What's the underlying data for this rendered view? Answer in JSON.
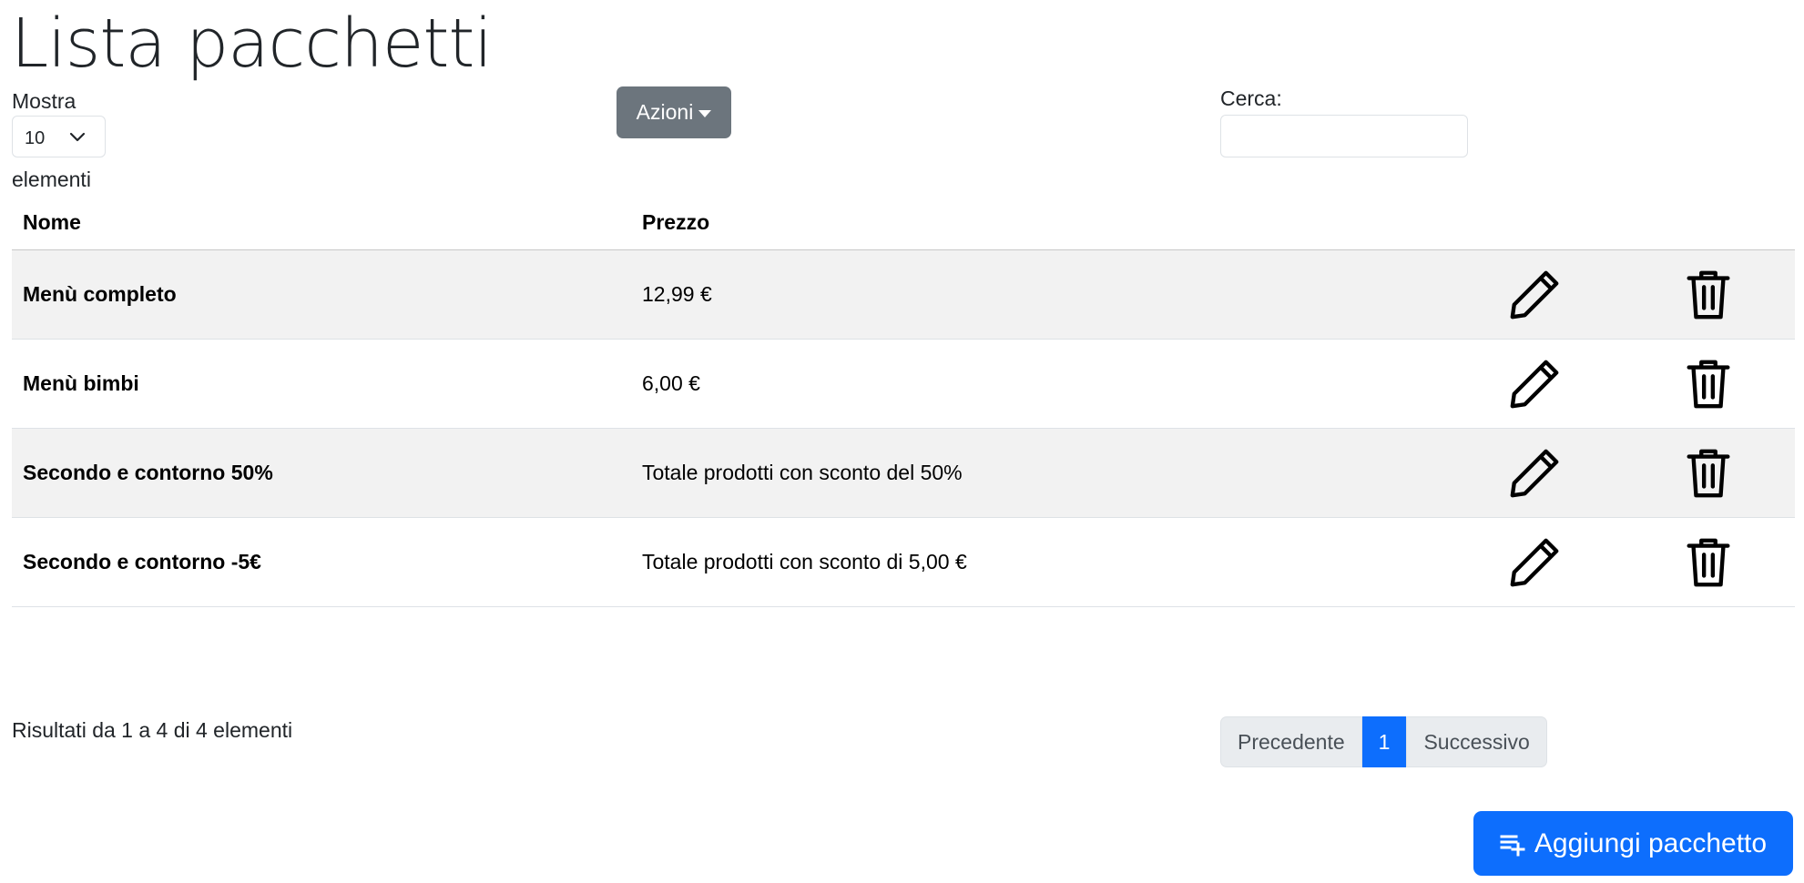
{
  "page": {
    "title": "Lista pacchetti"
  },
  "length_menu": {
    "prefix": "Mostra",
    "value": "10",
    "suffix": "elementi"
  },
  "actions": {
    "label": "Azioni"
  },
  "search": {
    "label": "Cerca:",
    "value": ""
  },
  "table": {
    "columns": [
      "Nome",
      "Prezzo"
    ],
    "rows": [
      {
        "name": "Menù completo",
        "price": "12,99 €"
      },
      {
        "name": "Menù bimbi",
        "price": "6,00 €"
      },
      {
        "name": "Secondo e contorno 50%",
        "price": "Totale prodotti con sconto del 50%"
      },
      {
        "name": "Secondo e contorno -5€",
        "price": "Totale prodotti con sconto di 5,00 €"
      }
    ]
  },
  "footer": {
    "info": "Risultati da 1 a 4 di 4 elementi",
    "pagination": {
      "prev": "Precedente",
      "current": "1",
      "next": "Successivo"
    },
    "add_button": "Aggiungi pacchetto"
  },
  "icons": {
    "edit": "pencil-icon",
    "delete": "trash-icon",
    "dropdown": "caret-down-icon",
    "select": "chevron-down-icon",
    "add": "playlist-add-icon"
  },
  "colors": {
    "primary": "#0d6efd",
    "secondary": "#6c757d",
    "row_stripe": "#f2f2f2"
  }
}
